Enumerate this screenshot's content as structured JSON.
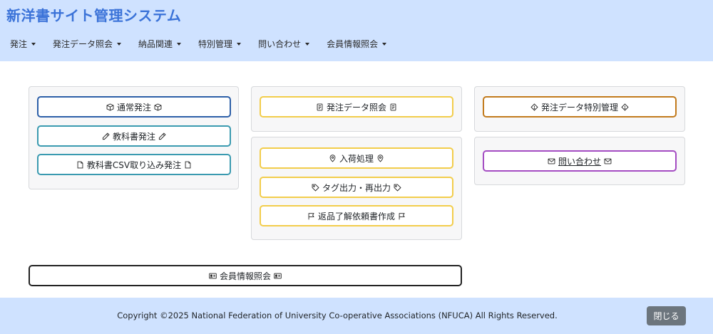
{
  "header": {
    "title": "新洋書サイト管理システム",
    "nav": [
      "発注",
      "発注データ照会",
      "納品関連",
      "特別管理",
      "問い合わせ",
      "会員情報照会"
    ]
  },
  "buttons": {
    "normal_order": "通常発注",
    "textbook_order": "教科書発注",
    "textbook_csv": "教科書CSV取り込み発注",
    "order_data_inquiry": "発注データ照会",
    "receiving": "入荷処理",
    "tag_output": "タグ出力・再出力",
    "return_request": "返品了解依頼書作成",
    "special_order_mgmt": "発注データ特別管理",
    "contact": "問い合わせ",
    "member_info": "会員情報照会"
  },
  "footer": {
    "copyright": "Copyright ©2025 National Federation of University Co-operative Associations (NFUCA) All Rights Reserved.",
    "close_label": "閉じる"
  },
  "colors": {
    "header_bg": "#cfe2ff",
    "title": "#3a72d8",
    "border_blue": "#2d5fa8",
    "border_teal": "#3a9ab0",
    "border_yellow": "#f2cd4b",
    "border_orange": "#c27a1c",
    "border_purple": "#a44cc2",
    "close_button": "#6c757d"
  },
  "icons": [
    "box-icon",
    "pencil-icon",
    "file-icon",
    "receipt-icon",
    "geo-pin-icon",
    "tag-icon",
    "flag-icon",
    "diamond-exclamation-icon",
    "envelope-icon",
    "person-card-icon"
  ]
}
